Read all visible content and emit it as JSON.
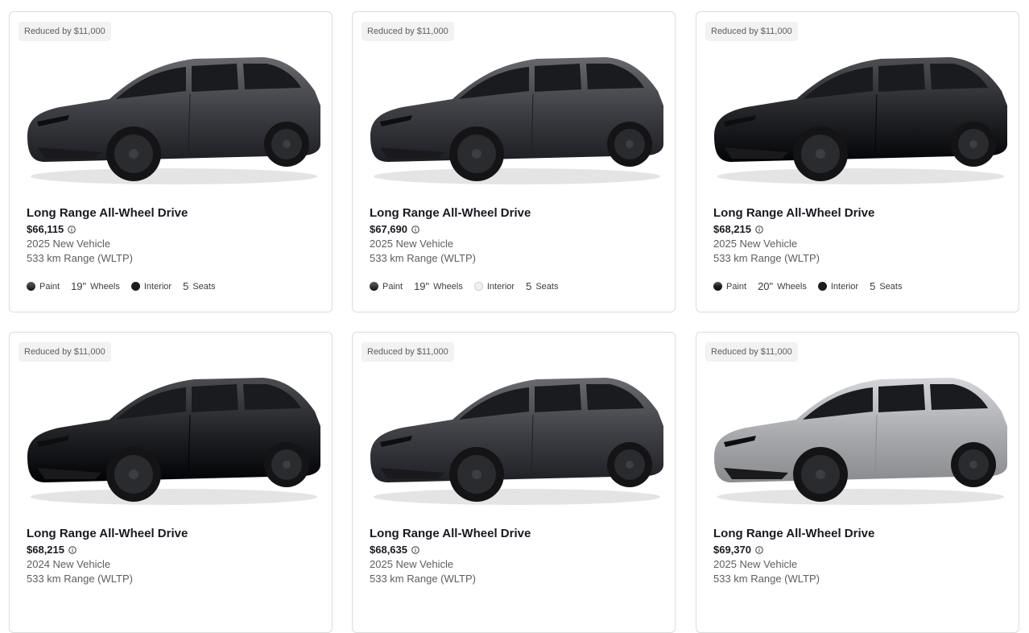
{
  "cards": [
    {
      "badge": "Reduced by $11,000",
      "title": "Long Range All-Wheel Drive",
      "price": "$66,115",
      "year": "2025 New Vehicle",
      "range": "533 km Range (WLTP)",
      "paint_label": "Paint",
      "wheels_num": "19\"",
      "wheels_label": "Wheels",
      "interior_label": "Interior",
      "seats_num": "5",
      "seats_label": "Seats",
      "paint_color": "#3a3b3f",
      "interior_color": "#1c1c1c",
      "body_color": "#3b3c41"
    },
    {
      "badge": "Reduced by $11,000",
      "title": "Long Range All-Wheel Drive",
      "price": "$67,690",
      "year": "2025 New Vehicle",
      "range": "533 km Range (WLTP)",
      "paint_label": "Paint",
      "wheels_num": "19\"",
      "wheels_label": "Wheels",
      "interior_label": "Interior",
      "seats_num": "5",
      "seats_label": "Seats",
      "paint_color": "#3a3b3f",
      "interior_color": "#f1f1f1",
      "body_color": "#3b3c41"
    },
    {
      "badge": "Reduced by $11,000",
      "title": "Long Range All-Wheel Drive",
      "price": "$68,215",
      "year": "2025 New Vehicle",
      "range": "533 km Range (WLTP)",
      "paint_label": "Paint",
      "wheels_num": "20\"",
      "wheels_label": "Wheels",
      "interior_label": "Interior",
      "seats_num": "5",
      "seats_label": "Seats",
      "paint_color": "#1e1e20",
      "interior_color": "#1c1c1c",
      "body_color": "#222326"
    },
    {
      "badge": "Reduced by $11,000",
      "title": "Long Range All-Wheel Drive",
      "price": "$68,215",
      "year": "2024 New Vehicle",
      "range": "533 km Range (WLTP)",
      "paint_color": "#1e1e20",
      "interior_color": "#1c1c1c",
      "body_color": "#1f2023"
    },
    {
      "badge": "Reduced by $11,000",
      "title": "Long Range All-Wheel Drive",
      "price": "$68,635",
      "year": "2025 New Vehicle",
      "range": "533 km Range (WLTP)",
      "paint_color": "#3a3b3f",
      "interior_color": "#1c1c1c",
      "body_color": "#3d3e43"
    },
    {
      "badge": "Reduced by $11,000",
      "title": "Long Range All-Wheel Drive",
      "price": "$69,370",
      "year": "2025 New Vehicle",
      "range": "533 km Range (WLTP)",
      "paint_color": "#a9abaf",
      "interior_color": "#1c1c1c",
      "body_color": "#a7a9ad"
    }
  ]
}
